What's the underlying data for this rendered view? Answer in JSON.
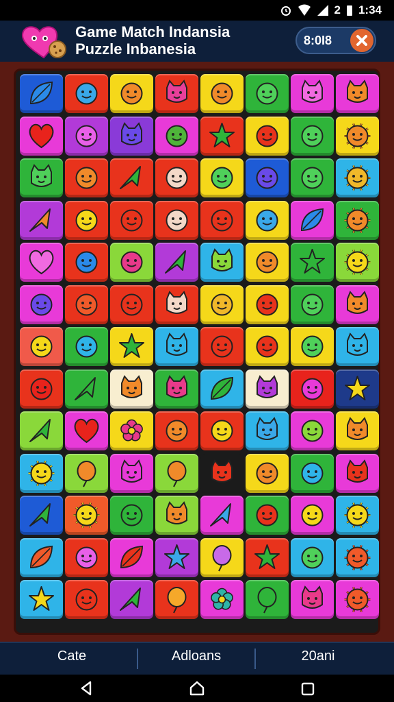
{
  "status_bar": {
    "time": "1:34",
    "sim_label": "2"
  },
  "header": {
    "title_line1": "Game Match Indansia",
    "title_line2": "Puzzle  Inbanesia",
    "timer": "8:0I8",
    "close_icon": "close-x-icon"
  },
  "board": {
    "rows": [
      [
        [
          "#1e5bd6",
          "leaf",
          "#2b8ae8"
        ],
        [
          "#e8331c",
          "face",
          "#3aa8e8"
        ],
        [
          "#f5d81a",
          "face",
          "#f08a2a"
        ],
        [
          "#e8331c",
          "cat",
          "#e83f9a"
        ],
        [
          "#f5d81a",
          "face",
          "#f08a2a"
        ],
        [
          "#2fb43a",
          "face",
          "#4fd05a"
        ],
        [
          "#e83ad8",
          "cat",
          "#f06ae0"
        ],
        [
          "#e83ad8",
          "cat",
          "#f08a2a"
        ]
      ],
      [
        [
          "#e83ad8",
          "heart",
          "#e8231c"
        ],
        [
          "#b23ad8",
          "face",
          "#e860e8"
        ],
        [
          "#8a3ad8",
          "cat",
          "#6a4ae8"
        ],
        [
          "#e83ad8",
          "face",
          "#4fb43a"
        ],
        [
          "#e8331c",
          "star",
          "#2fb43a"
        ],
        [
          "#f5d81a",
          "face",
          "#e8331c"
        ],
        [
          "#2fb43a",
          "face",
          "#4fd05a"
        ],
        [
          "#f5d81a",
          "sun",
          "#f08a2a"
        ]
      ],
      [
        [
          "#2fb43a",
          "cat",
          "#4fd05a"
        ],
        [
          "#e8331c",
          "face",
          "#f08a2a"
        ],
        [
          "#e8331c",
          "arrow",
          "#2fb43a"
        ],
        [
          "#e8331c",
          "face",
          "#f3d8c8"
        ],
        [
          "#f5d81a",
          "face",
          "#4fd05a"
        ],
        [
          "#1e5bd6",
          "face",
          "#6a4ae8"
        ],
        [
          "#2fb43a",
          "face",
          "#4fd05a"
        ],
        [
          "#2fb4e8",
          "sun",
          "#f0b82a"
        ]
      ],
      [
        [
          "#b23ad8",
          "arrow",
          "#f08a2a"
        ],
        [
          "#e8331c",
          "face",
          "#f5d81a"
        ],
        [
          "#e8331c",
          "face",
          "#e8331c"
        ],
        [
          "#e8331c",
          "face",
          "#f3d8c8"
        ],
        [
          "#e8331c",
          "face",
          "#e8331c"
        ],
        [
          "#f5d81a",
          "face",
          "#3aa8e8"
        ],
        [
          "#e83ad8",
          "leaf",
          "#2b8ae8"
        ],
        [
          "#2fb43a",
          "sun",
          "#f08a2a"
        ]
      ],
      [
        [
          "#e83ad8",
          "heart",
          "#f06ae0"
        ],
        [
          "#e8331c",
          "face",
          "#2b8ae8"
        ],
        [
          "#8ad83a",
          "face",
          "#e83a8a"
        ],
        [
          "#b23ad8",
          "arrow",
          "#2fb43a"
        ],
        [
          "#2fb4e8",
          "cat",
          "#8ad83a"
        ],
        [
          "#f5d81a",
          "face",
          "#f08a2a"
        ],
        [
          "#2fb43a",
          "star",
          "#2fb43a"
        ],
        [
          "#8ad83a",
          "sun",
          "#f5d81a"
        ]
      ],
      [
        [
          "#e83ad8",
          "face",
          "#6a4ae8"
        ],
        [
          "#e8331c",
          "face",
          "#f05a2a"
        ],
        [
          "#e8331c",
          "face",
          "#e8331c"
        ],
        [
          "#e8331c",
          "cat",
          "#f3d8c8"
        ],
        [
          "#f5d81a",
          "face",
          "#f0b82a"
        ],
        [
          "#f5d81a",
          "face",
          "#e8331c"
        ],
        [
          "#2fb43a",
          "face",
          "#4fd05a"
        ],
        [
          "#e83ad8",
          "cat",
          "#f08a2a"
        ]
      ],
      [
        [
          "#f05a4a",
          "face",
          "#f5d81a"
        ],
        [
          "#2fb43a",
          "face",
          "#2fb4e8"
        ],
        [
          "#f5d81a",
          "star",
          "#2fb43a"
        ],
        [
          "#2fb4e8",
          "cat",
          "#2fb4e8"
        ],
        [
          "#e8331c",
          "face",
          "#e8331c"
        ],
        [
          "#f5d81a",
          "face",
          "#e8331c"
        ],
        [
          "#f5d81a",
          "face",
          "#4fd05a"
        ],
        [
          "#2fb4e8",
          "cat",
          "#2fb4e8"
        ]
      ],
      [
        [
          "#e8331c",
          "face",
          "#e8231c"
        ],
        [
          "#2fb43a",
          "arrow",
          "#2fb43a"
        ],
        [
          "#f8eed0",
          "cat",
          "#f08a2a"
        ],
        [
          "#2fb43a",
          "cat",
          "#e83a8a"
        ],
        [
          "#2fb4e8",
          "leaf",
          "#2fb43a"
        ],
        [
          "#f8eed0",
          "cat",
          "#b23ad8"
        ],
        [
          "#e8231c",
          "face",
          "#e83ad8"
        ],
        [
          "#1e3a8a",
          "star",
          "#f5d81a"
        ]
      ],
      [
        [
          "#8ad83a",
          "arrow",
          "#2fb43a"
        ],
        [
          "#e83ad8",
          "heart",
          "#e8231c"
        ],
        [
          "#f5d81a",
          "flower",
          "#e83a8a"
        ],
        [
          "#e8331c",
          "face",
          "#f08a2a"
        ],
        [
          "#e8331c",
          "face",
          "#f5d81a"
        ],
        [
          "#2fb4e8",
          "cat",
          "#3aa8e8"
        ],
        [
          "#e83ad8",
          "face",
          "#8ad83a"
        ],
        [
          "#f5d81a",
          "cat",
          "#f08a2a"
        ]
      ],
      [
        [
          "#2fb4e8",
          "sun",
          "#f5d81a"
        ],
        [
          "#8ad83a",
          "balloon",
          "#f08a2a"
        ],
        [
          "#e83ad8",
          "cat",
          "#e83ad8"
        ],
        [
          "#8ad83a",
          "balloon",
          "#f08a2a"
        ],
        [
          "#1b1b1b",
          "cat",
          "#e8331c"
        ],
        [
          "#f5d81a",
          "face",
          "#f08a2a"
        ],
        [
          "#2fb43a",
          "face",
          "#2fb4e8"
        ],
        [
          "#e83ad8",
          "cat",
          "#e8331c"
        ]
      ],
      [
        [
          "#1e5bd6",
          "arrow",
          "#2fb43a"
        ],
        [
          "#f05a2a",
          "sun",
          "#f5d81a"
        ],
        [
          "#2fb43a",
          "face",
          "#2fb43a"
        ],
        [
          "#8ad83a",
          "cat",
          "#f08a2a"
        ],
        [
          "#e83ad8",
          "arrow",
          "#3aa8e8"
        ],
        [
          "#2fb43a",
          "face",
          "#e8331c"
        ],
        [
          "#e83ad8",
          "face",
          "#f5d81a"
        ],
        [
          "#2fb4e8",
          "sun",
          "#f5d81a"
        ]
      ],
      [
        [
          "#2fb4e8",
          "leaf",
          "#f05a2a"
        ],
        [
          "#e8331c",
          "face",
          "#e860e8"
        ],
        [
          "#e83ad8",
          "leaf",
          "#e8331c"
        ],
        [
          "#b23ad8",
          "star",
          "#3aa8e8"
        ],
        [
          "#f5d81a",
          "balloon",
          "#c86ae8"
        ],
        [
          "#e8331c",
          "star",
          "#2fb43a"
        ],
        [
          "#2fb4e8",
          "face",
          "#4fd05a"
        ],
        [
          "#2fb4e8",
          "sun",
          "#f05a2a"
        ]
      ],
      [
        [
          "#2fb4e8",
          "star",
          "#f5d81a"
        ],
        [
          "#e8331c",
          "face",
          "#e8331c"
        ],
        [
          "#b23ad8",
          "arrow",
          "#2fb43a"
        ],
        [
          "#e8331c",
          "balloon",
          "#f5a82a"
        ],
        [
          "#e83ad8",
          "flower",
          "#2fb4a8"
        ],
        [
          "#2fb43a",
          "balloon",
          "#2fb43a"
        ],
        [
          "#e83ad8",
          "cat",
          "#e83a8a"
        ],
        [
          "#e83ad8",
          "sun",
          "#f05a2a"
        ]
      ]
    ]
  },
  "bottom_tabs": {
    "left": "Cate",
    "middle": "Adloans",
    "right": "20ani"
  },
  "nav_icons": [
    "back-triangle-icon",
    "home-icon",
    "recents-icon"
  ]
}
